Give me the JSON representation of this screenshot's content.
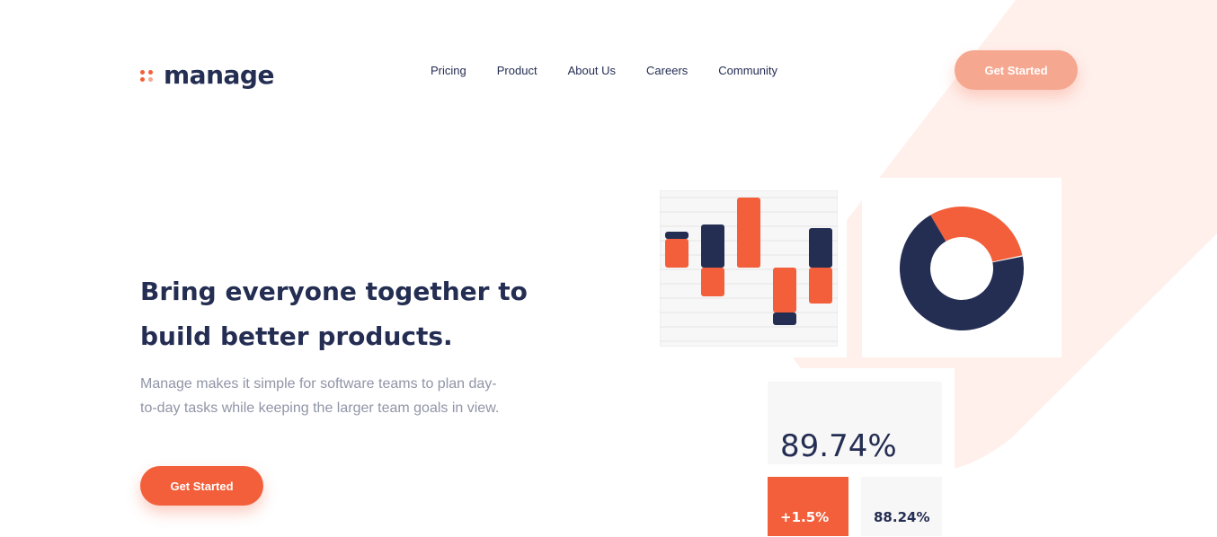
{
  "brand": {
    "name": "manage",
    "accent": "#f25f3a",
    "accent_light": "#f6a78f",
    "navy": "#242d52",
    "muted": "#9095a7"
  },
  "nav": {
    "items": [
      "Pricing",
      "Product",
      "About Us",
      "Careers",
      "Community"
    ]
  },
  "header": {
    "cta_label": "Get Started"
  },
  "hero": {
    "title": "Bring everyone together to build better products.",
    "description": "Manage makes it simple for software teams to plan day-to-day tasks while keeping the larger team goals in view.",
    "cta_label": "Get Started"
  },
  "illustration": {
    "bar_chart": {
      "bars": [
        {
          "orange": [
            0,
            0.8
          ],
          "navy": [
            0.8,
            1.0
          ]
        },
        {
          "orange": [
            -0.8,
            0
          ],
          "navy": [
            0,
            1.2
          ]
        },
        {
          "orange": [
            0,
            1.95
          ],
          "navy": [
            0,
            0.8
          ]
        },
        {
          "orange": [
            -1.25,
            0
          ],
          "navy": [
            -1.6,
            -1.25
          ]
        },
        {
          "orange": [
            -1.0,
            0
          ],
          "navy": [
            0,
            1.1
          ]
        }
      ]
    },
    "donut": {
      "orange_fraction": 0.3,
      "navy_fraction": 0.7
    },
    "stats": {
      "main": "89.74%",
      "positive": "+1.5%",
      "secondary": "88.24%"
    }
  }
}
